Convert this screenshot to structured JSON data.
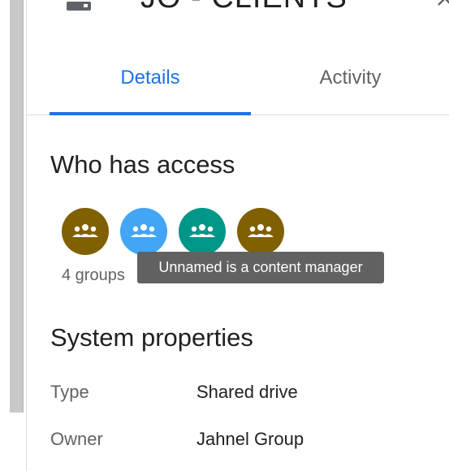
{
  "header": {
    "title": "JO - CLIENTS",
    "icon": "shared-drive-icon",
    "close_icon": "close-icon"
  },
  "tabs": [
    {
      "label": "Details",
      "active": true
    },
    {
      "label": "Activity",
      "active": false
    }
  ],
  "access": {
    "title": "Who has access",
    "groups": [
      {
        "icon": "group-icon",
        "color": "#806000"
      },
      {
        "icon": "group-icon",
        "color": "#42a5f5"
      },
      {
        "icon": "group-icon",
        "color": "#009688"
      },
      {
        "icon": "group-icon",
        "color": "#806000"
      }
    ],
    "count_label": "4 groups",
    "tooltip": "Unnamed is a content manager"
  },
  "system": {
    "title": "System properties",
    "rows": [
      {
        "label": "Type",
        "value": "Shared drive"
      },
      {
        "label": "Owner",
        "value": "Jahnel Group"
      }
    ]
  },
  "colors": {
    "accent": "#1a73e8",
    "text_primary": "#202124",
    "text_secondary": "#5f6368",
    "tooltip_bg": "#616161"
  }
}
